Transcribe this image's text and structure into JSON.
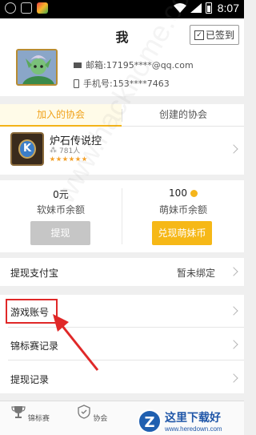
{
  "status_bar": {
    "time": "8:07",
    "icons": [
      "notification-icon",
      "app-icon",
      "game-icon",
      "wifi-icon",
      "signal-icon",
      "battery-icon"
    ]
  },
  "header": {
    "title": "我",
    "signin_label": "已签到"
  },
  "profile": {
    "email": "邮箱:17195****@qq.com",
    "phone": "手机号:153****7463"
  },
  "guild": {
    "tabs": [
      {
        "label": "加入的协会",
        "active": true
      },
      {
        "label": "创建的协会",
        "active": false
      }
    ],
    "item": {
      "name": "炉石传说控",
      "members": "781人",
      "stars": 6,
      "logo_letter": "K"
    }
  },
  "balances": {
    "soft": {
      "value": "0元",
      "label": "软妹币余额",
      "button": "提现"
    },
    "cute": {
      "value": "100",
      "label": "萌妹币余额",
      "button": "兑现萌妹币"
    }
  },
  "rows": [
    {
      "label": "提现支付宝",
      "value": "暂未绑定"
    },
    {
      "label": "游戏账号",
      "value": ""
    },
    {
      "label": "锦标赛记录",
      "value": ""
    },
    {
      "label": "提现记录",
      "value": ""
    }
  ],
  "tabbar": [
    {
      "label": "锦标赛",
      "icon": "trophy-icon"
    },
    {
      "label": "协会",
      "icon": "shield-icon"
    }
  ],
  "watermarks": {
    "site": "www.hackhome.com",
    "brand_main": "这里下载好",
    "brand_sub": "www.heredown.com",
    "brand_logo": "Z"
  },
  "colors": {
    "accent": "#f3b318",
    "highlight": "#e02828",
    "disabled_button": "#c6c6c6"
  }
}
